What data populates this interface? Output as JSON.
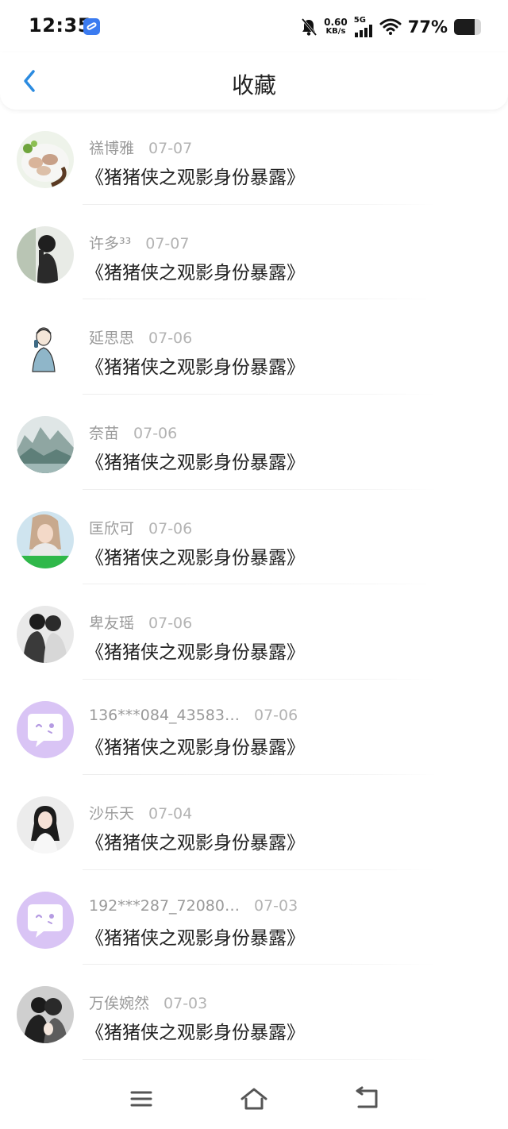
{
  "status_bar": {
    "time": "12:35",
    "net_speed": "0.60",
    "net_unit": "KB/s",
    "network_type": "5G",
    "battery_percent": "77%",
    "battery_level": 0.77,
    "icons": [
      "app-notification-icon",
      "mute-bell-icon",
      "signal-icon",
      "wifi-icon",
      "battery-icon"
    ]
  },
  "header": {
    "title": "收藏",
    "back_icon": "chevron-left-icon",
    "accent_color": "#2b8be0"
  },
  "favorites": [
    {
      "name": "禚博雅",
      "date": "07-07",
      "title": "《猪猪侠之观影身份暴露》"
    },
    {
      "name": "许多³³",
      "date": "07-07",
      "title": "《猪猪侠之观影身份暴露》"
    },
    {
      "name": "延思思",
      "date": "07-06",
      "title": "《猪猪侠之观影身份暴露》"
    },
    {
      "name": "奈苗",
      "date": "07-06",
      "title": "《猪猪侠之观影身份暴露》"
    },
    {
      "name": "匡欣可",
      "date": "07-06",
      "title": "《猪猪侠之观影身份暴露》"
    },
    {
      "name": "卑友瑶",
      "date": "07-06",
      "title": "《猪猪侠之观影身份暴露》"
    },
    {
      "name": "136***084_43583…",
      "date": "07-06",
      "title": "《猪猪侠之观影身份暴露》"
    },
    {
      "name": "沙乐天",
      "date": "07-04",
      "title": "《猪猪侠之观影身份暴露》"
    },
    {
      "name": "192***287_72080…",
      "date": "07-03",
      "title": "《猪猪侠之观影身份暴露》"
    },
    {
      "name": "万俟婉然",
      "date": "07-03",
      "title": "《猪猪侠之观影身份暴露》"
    }
  ],
  "nav_bar": {
    "icons": [
      "menu-icon",
      "home-icon",
      "back-icon"
    ]
  }
}
